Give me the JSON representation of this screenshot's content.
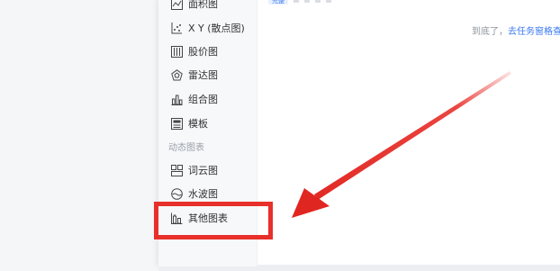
{
  "tabs": {
    "active_label": "完整"
  },
  "end_message": {
    "text": "到底了，",
    "link": "去任务窗格查看"
  },
  "sidebar": {
    "items": [
      {
        "label": "面积图",
        "icon": "area-chart-icon"
      },
      {
        "label": "X Y (散点图)",
        "icon": "scatter-chart-icon"
      },
      {
        "label": "股价图",
        "icon": "stock-chart-icon"
      },
      {
        "label": "雷达图",
        "icon": "radar-chart-icon"
      },
      {
        "label": "组合图",
        "icon": "combo-chart-icon"
      },
      {
        "label": "模板",
        "icon": "template-icon"
      }
    ],
    "section_title": "动态图表",
    "dynamic_items": [
      {
        "label": "词云图",
        "icon": "word-cloud-icon"
      },
      {
        "label": "水波图",
        "icon": "water-wave-icon"
      },
      {
        "label": "其他图表",
        "icon": "other-chart-icon"
      }
    ]
  },
  "annotation": {
    "color": "#e8302b"
  }
}
